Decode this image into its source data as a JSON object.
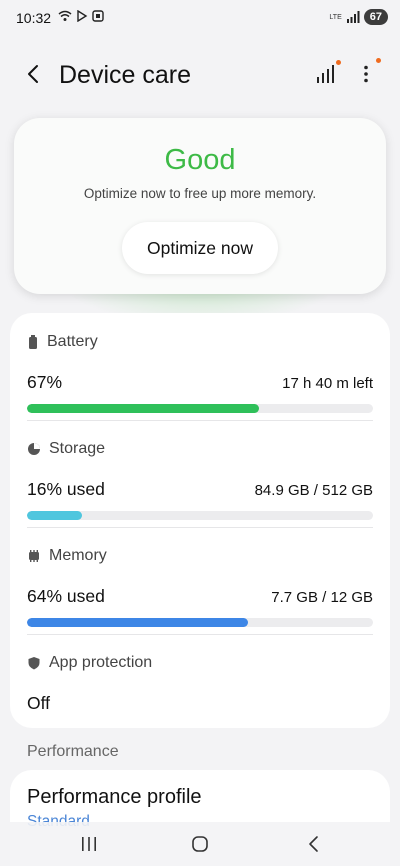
{
  "status_bar": {
    "time": "10:32",
    "network": "LTE",
    "battery_level": "67"
  },
  "header": {
    "title": "Device care"
  },
  "status_card": {
    "status": "Good",
    "status_color": "#3dba46",
    "message": "Optimize now to free up more memory.",
    "optimize_label": "Optimize now"
  },
  "metrics": {
    "battery": {
      "label": "Battery",
      "value": "67%",
      "detail": "17 h 40 m left",
      "fill_fraction": 0.67,
      "color": "#2fc05a"
    },
    "storage": {
      "label": "Storage",
      "value": "16% used",
      "detail": "84.9 GB / 512 GB",
      "fill_fraction": 0.16,
      "color": "#4fc6de"
    },
    "memory": {
      "label": "Memory",
      "value": "64% used",
      "detail": "7.7 GB / 12 GB",
      "fill_fraction": 0.64,
      "color": "#3d86e6"
    },
    "app_protection": {
      "label": "App protection",
      "value": "Off"
    }
  },
  "performance": {
    "section_label": "Performance",
    "profile_label": "Performance profile",
    "profile_value": "Standard"
  },
  "icons": {
    "back": "back-arrow-icon",
    "signal": "signal-bars-icon",
    "more": "more-vertical-icon"
  }
}
